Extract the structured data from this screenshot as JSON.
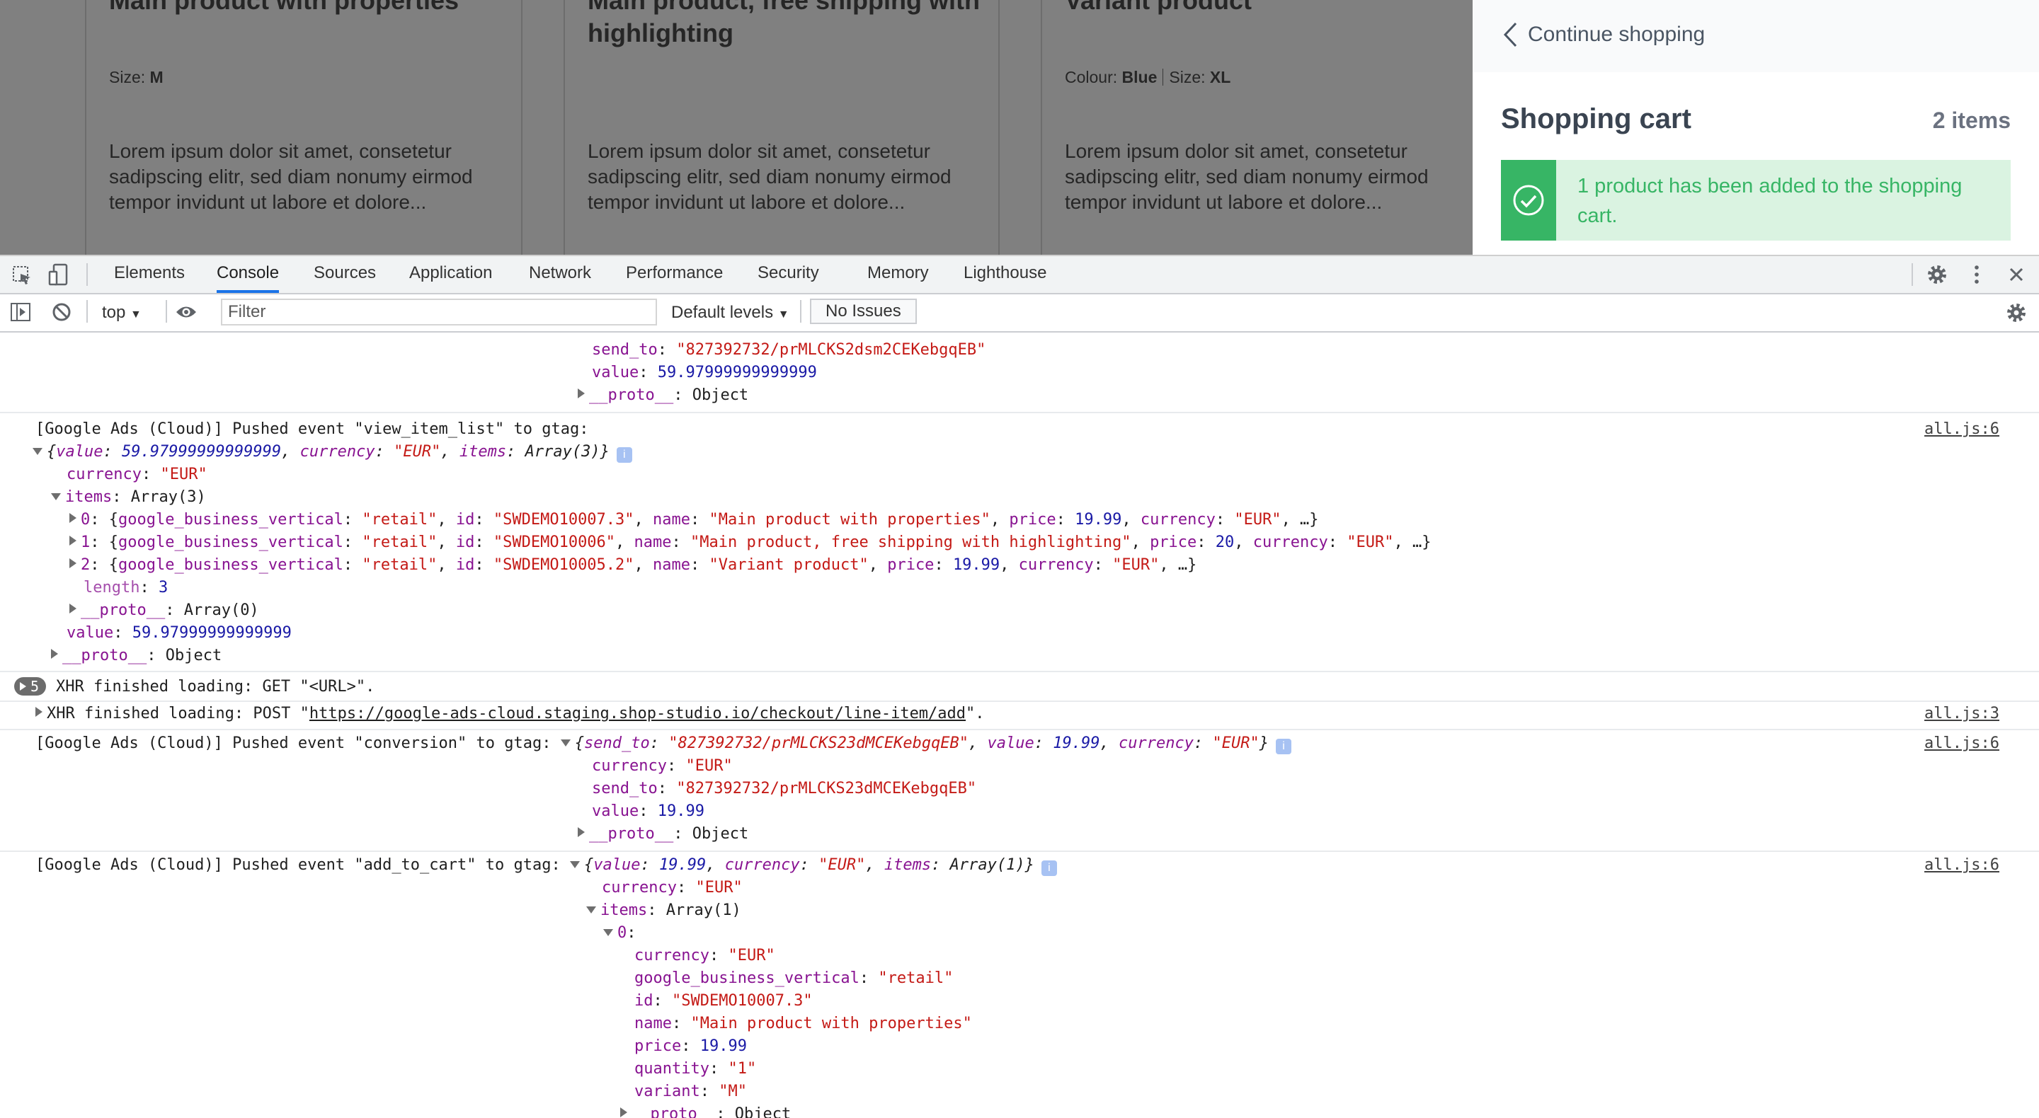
{
  "products": [
    {
      "title": "Main product with properties",
      "meta": [
        {
          "label": "Size: ",
          "value": "M"
        }
      ],
      "description": "Lorem ipsum dolor sit amet, consetetur sadipscing elitr, sed diam nonumy eirmod tempor invidunt ut labore et dolore..."
    },
    {
      "title": "Main product, free shipping with highlighting",
      "meta": [],
      "description": "Lorem ipsum dolor sit amet, consetetur sadipscing elitr, sed diam nonumy eirmod tempor invidunt ut labore et dolore..."
    },
    {
      "title": "Variant product",
      "meta": [
        {
          "label": "Colour: ",
          "value": "Blue"
        },
        {
          "label": "Size: ",
          "value": "XL"
        }
      ],
      "description": "Lorem ipsum dolor sit amet, consetetur sadipscing elitr, sed diam nonumy eirmod tempor invidunt ut labore et dolore..."
    }
  ],
  "cart": {
    "continue_label": "Continue shopping",
    "title": "Shopping cart",
    "count": "2 items",
    "alert": "1 product has been added to the shopping cart."
  },
  "devtools": {
    "tabs": [
      "Elements",
      "Console",
      "Sources",
      "Application",
      "Network",
      "Performance",
      "Security",
      "Memory",
      "Lighthouse"
    ],
    "active_tab": "Console",
    "context": "top",
    "filter_placeholder": "Filter",
    "levels": "Default levels",
    "issues": "No Issues",
    "icons": [
      "inspect-icon",
      "device-icon",
      "settings-icon",
      "more-icon",
      "close-icon",
      "sidebar-icon",
      "clear-icon",
      "eye-icon"
    ]
  },
  "console": {
    "prev": {
      "send_to_key": "send_to",
      "send_to": "\"827392732/prMLCKS2dsm2CEKebgqEB\"",
      "value_key": "value",
      "value": "59.97999999999999",
      "proto_key": "__proto__",
      "proto": ": Object"
    },
    "view_item_list": {
      "header": "[Google Ads (Cloud)] Pushed event \"view_item_list\" to gtag:",
      "src": "all.js:6",
      "summary": {
        "value_key": "value",
        "value": "59.97999999999999",
        "currency_key": "currency",
        "currency": "\"EUR\"",
        "items_key": "items",
        "items": "Array(3)"
      },
      "currency": "\"EUR\"",
      "items_label": "Array(3)",
      "items": [
        {
          "idx": "0",
          "vertical": "\"retail\"",
          "id": "\"SWDEMO10007.3\"",
          "name": "\"Main product with properties\"",
          "price": "19.99",
          "currency": "\"EUR\""
        },
        {
          "idx": "1",
          "vertical": "\"retail\"",
          "id": "\"SWDEMO10006\"",
          "name": "\"Main product, free shipping with highlighting\"",
          "price": "20",
          "currency": "\"EUR\""
        },
        {
          "idx": "2",
          "vertical": "\"retail\"",
          "id": "\"SWDEMO10005.2\"",
          "name": "\"Variant product\"",
          "price": "19.99",
          "currency": "\"EUR\""
        }
      ],
      "length": "3",
      "array_proto": "Array(0)",
      "value": "59.97999999999999",
      "object_proto": "Object"
    },
    "xhr_get": {
      "count": "5",
      "text": "XHR finished loading: GET \"<URL>\"."
    },
    "xhr_post": {
      "text_before": "XHR finished loading: POST \"",
      "url": "https://google-ads-cloud.staging.shop-studio.io/checkout/line-item/add",
      "text_after": "\".",
      "src": "all.js:3"
    },
    "conversion": {
      "header": "[Google Ads (Cloud)] Pushed event \"conversion\" to gtag: ",
      "src": "all.js:6",
      "summary": {
        "send_to": "\"827392732/prMLCKS23dMCEKebgqEB\"",
        "value": "19.99",
        "currency": "\"EUR\""
      },
      "currency": "\"EUR\"",
      "send_to": "\"827392732/prMLCKS23dMCEKebgqEB\"",
      "value": "19.99",
      "proto": "Object"
    },
    "add_to_cart": {
      "header": "[Google Ads (Cloud)] Pushed event \"add_to_cart\" to gtag: ",
      "src": "all.js:6",
      "summary": {
        "value": "19.99",
        "currency": "\"EUR\"",
        "items": "Array(1)"
      },
      "currency": "\"EUR\"",
      "items_label": "Array(1)",
      "item": {
        "idx": "0",
        "currency": "\"EUR\"",
        "vertical": "\"retail\"",
        "id": "\"SWDEMO10007.3\"",
        "name": "\"Main product with properties\"",
        "price": "19.99",
        "quantity": "\"1\"",
        "variant": "\"M\"",
        "proto": "Object"
      }
    }
  }
}
